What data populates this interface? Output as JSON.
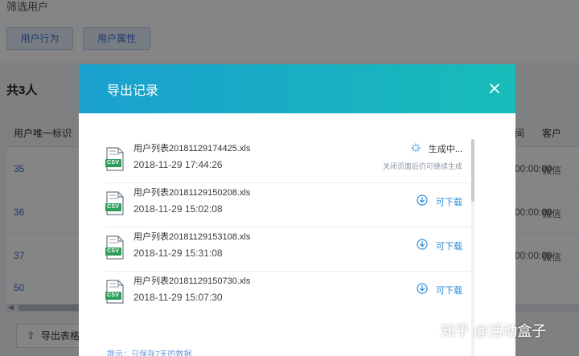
{
  "background": {
    "filter_title": "筛选用户",
    "tabs": [
      {
        "label": "用户行为"
      },
      {
        "label": "用户属性"
      }
    ],
    "count_label": "共3人",
    "table": {
      "col_id": "用户唯一标识",
      "col_time": "间",
      "col_client": "客户",
      "rows": [
        {
          "id": "35",
          "time": "00:00:00",
          "client": "微信"
        },
        {
          "id": "36",
          "time": "00:00:00",
          "client": "微信"
        },
        {
          "id": "37",
          "time": "00:00:00",
          "client": "微信"
        },
        {
          "id": "50",
          "time": "",
          "client": ""
        }
      ]
    },
    "export_button": "导出表格"
  },
  "modal": {
    "title": "导出记录",
    "close_icon": "close-icon",
    "items": [
      {
        "name": "用户列表20181129174425.xls",
        "date": "2018-11-29 17:44:26",
        "status": "生成中...",
        "sub": "关闭页面后仍可继续生成",
        "icon": "loading-spinner-icon"
      },
      {
        "name": "用户列表20181129150208.xls",
        "date": "2018-11-29 15:02:08",
        "status": "可下载",
        "icon": "download-icon"
      },
      {
        "name": "用户列表20181129153108.xls",
        "date": "2018-11-29 15:31:08",
        "status": "可下载",
        "icon": "download-icon"
      },
      {
        "name": "用户列表20181129150730.xls",
        "date": "2018-11-29 15:07:30",
        "status": "可下载",
        "icon": "download-icon"
      }
    ],
    "file_icon_label": "CSV",
    "footer_hint": "提示：只保存7天的数据"
  },
  "watermark": "知乎 @活动盒子",
  "colors": {
    "header_start": "#1aa0cf",
    "header_end": "#17bcb8",
    "link_blue": "#2b8bd8",
    "csv_green": "#2e9e5b"
  }
}
